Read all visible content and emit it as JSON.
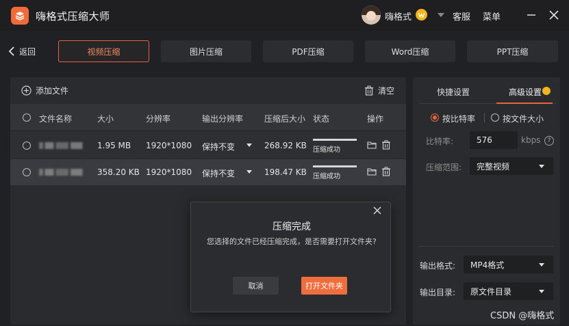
{
  "app": {
    "title": "嗨格式压缩大师",
    "username": "嗨格式",
    "links": {
      "service": "客服",
      "menu": "菜单"
    }
  },
  "nav": {
    "back_label": "返回",
    "tabs": [
      {
        "label": "视频压缩",
        "active": true
      },
      {
        "label": "图片压缩",
        "active": false
      },
      {
        "label": "PDF压缩",
        "active": false
      },
      {
        "label": "Word压缩",
        "active": false
      },
      {
        "label": "PPT压缩",
        "active": false
      }
    ]
  },
  "file_panel": {
    "add_label": "添加文件",
    "clear_label": "清空",
    "columns": [
      "文件名称",
      "大小",
      "分辨率",
      "输出分辨率",
      "压缩后大小",
      "状态",
      "操作"
    ],
    "rows": [
      {
        "size": "1.95 MB",
        "resolution": "1920*1080",
        "output_resolution": "保持不变",
        "compressed_size": "268.92 KB",
        "status": "压缩成功"
      },
      {
        "size": "358.20 KB",
        "resolution": "1920*1080",
        "output_resolution": "保持不变",
        "compressed_size": "198.47 KB",
        "status": "压缩成功"
      }
    ]
  },
  "settings": {
    "tab_quick": "快捷设置",
    "tab_advanced": "高级设置",
    "mode_bitrate": "按比特率",
    "mode_filesize": "按文件大小",
    "bitrate_label": "比特率:",
    "bitrate_value": "576",
    "bitrate_unit": "kbps",
    "range_label": "压缩范围:",
    "range_value": "完整视频",
    "format_label": "输出格式:",
    "format_value": "MP4格式",
    "dir_label": "输出目录:",
    "dir_value": "原文件目录",
    "help_glyph": "?"
  },
  "dialog": {
    "title": "压缩完成",
    "message": "您选择的文件已经压缩完成，是否需要打开文件夹?",
    "cancel_label": "取消",
    "open_label": "打开文件夹"
  },
  "watermark": "CSDN @嗨格式",
  "colors": {
    "accent": "#e8643a",
    "vip": "#f2b51c",
    "background": "#202124"
  }
}
